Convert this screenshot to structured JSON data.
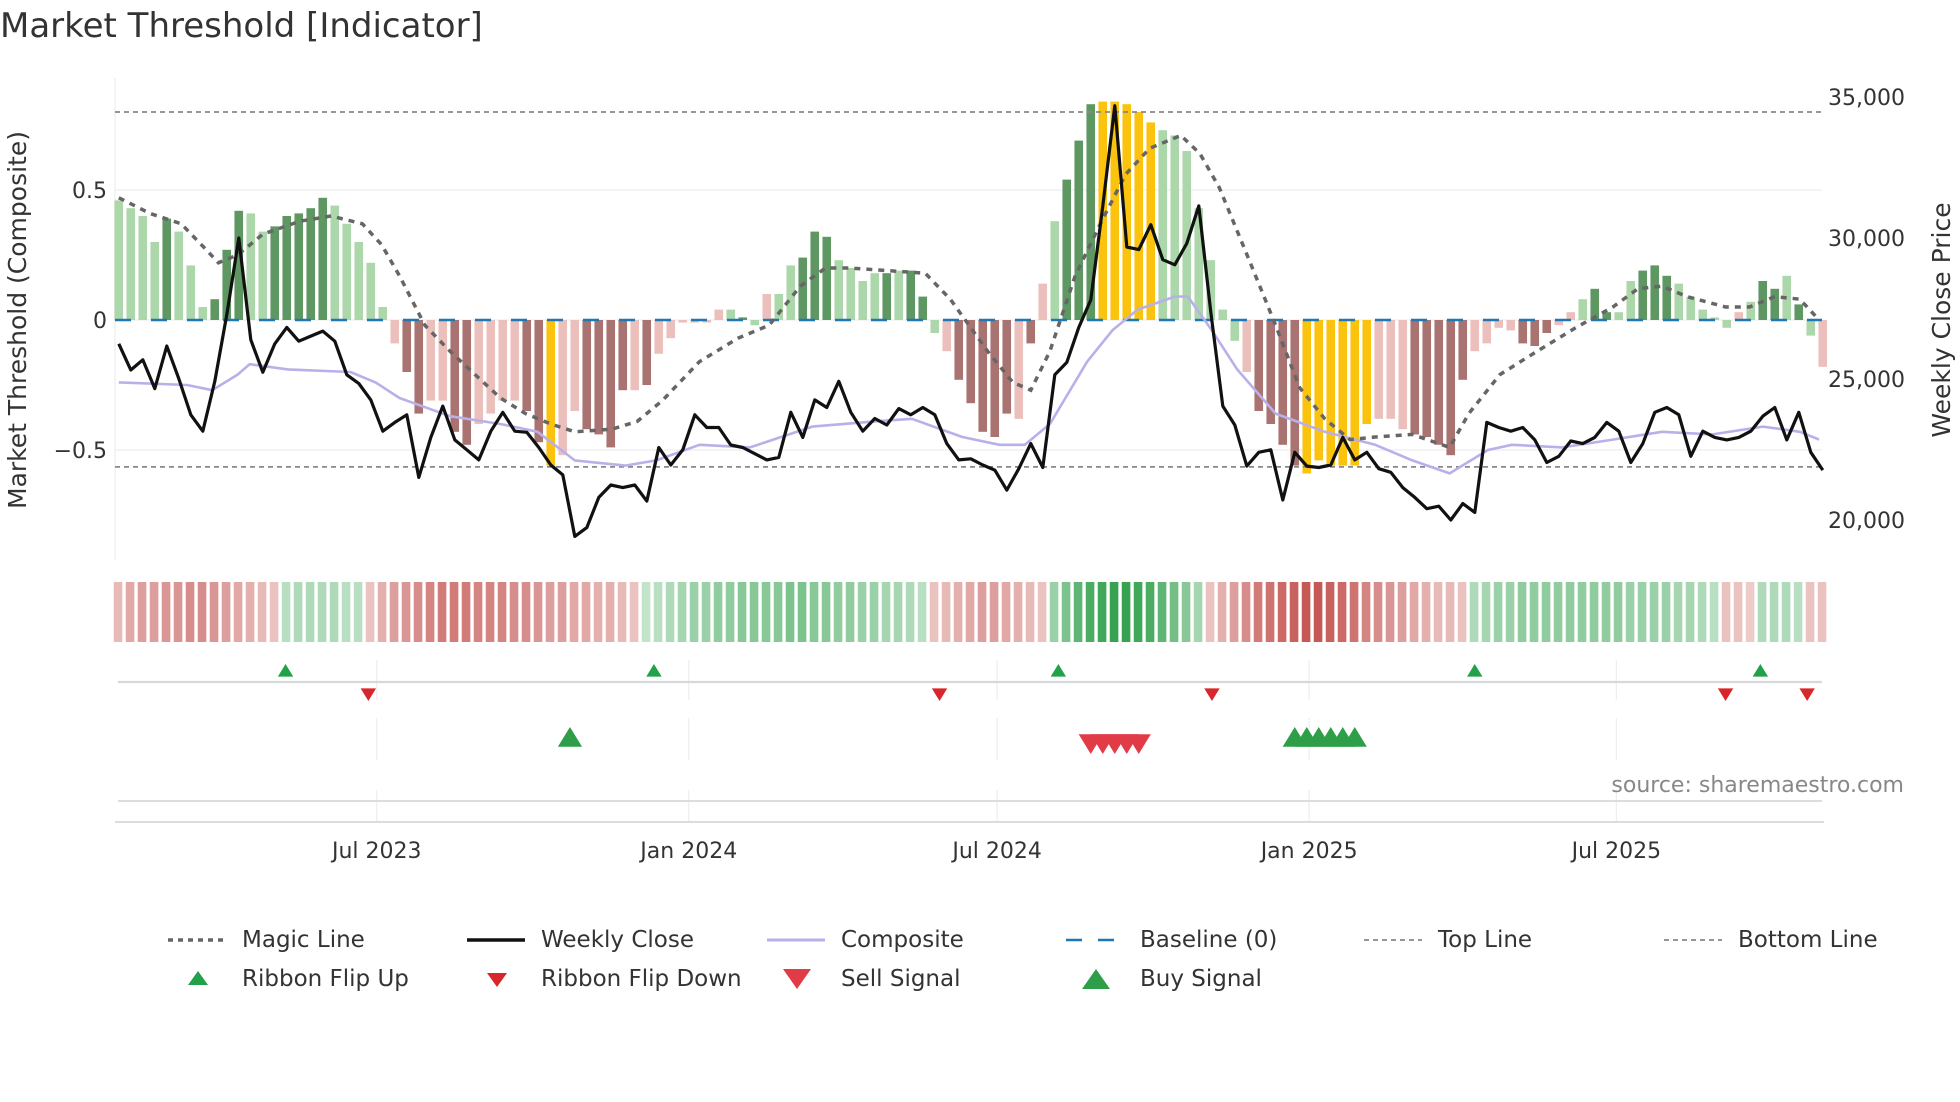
{
  "title": "Market Threshold [Indicator]",
  "source": "source: sharemaestro.com",
  "colors": {
    "bar_D": "#5f9763",
    "bar_L": "#acd7aa",
    "bar_d": "#a97371",
    "bar_l": "#ebc0bc",
    "bar_Y": "#fbc30d",
    "weekly_close": "#111111",
    "composite": "#b9b0ea",
    "magic": "#666666",
    "baseline": "#1f77b4",
    "ribbon_green": "#37a350",
    "ribbon_red": "#c2504c",
    "flip_up": "#21a148",
    "flip_down": "#d8262b",
    "sell": "#e23b48",
    "buy": "#2e9f48"
  },
  "chart_data": {
    "type": "bar+line",
    "title": "Market Threshold [Indicator]",
    "ylabel_left": "Market Threshold (Composite)",
    "ylabel_right": "Weekly Close Price",
    "ylim_left": [
      -0.94,
      0.92
    ],
    "ylim_right": [
      18600,
      36950
    ],
    "left_ticks": [
      {
        "v": 0.5,
        "label": "0.5"
      },
      {
        "v": 0,
        "label": "0"
      },
      {
        "v": -0.5,
        "label": "−0.5"
      }
    ],
    "right_ticks": [
      {
        "v": 35000,
        "label": "35,000"
      },
      {
        "v": 30000,
        "label": "30,000"
      },
      {
        "v": 25000,
        "label": "25,000"
      },
      {
        "v": 20000,
        "label": "20,000"
      }
    ],
    "x_ticks": [
      {
        "week": 21.5,
        "label": "Jul 2023"
      },
      {
        "week": 47.5,
        "label": "Jan 2024"
      },
      {
        "week": 73.2,
        "label": "Jul 2024"
      },
      {
        "week": 99.2,
        "label": "Jan 2025"
      },
      {
        "week": 124.8,
        "label": "Jul 2025"
      }
    ],
    "top_line": 0.8,
    "bottom_line": -0.565,
    "baseline": 0,
    "composite_bars": [
      0.46,
      0.43,
      0.4,
      0.3,
      0.39,
      0.34,
      0.21,
      0.05,
      0.08,
      0.27,
      0.42,
      0.41,
      0.34,
      0.36,
      0.4,
      0.41,
      0.43,
      0.47,
      0.44,
      0.37,
      0.3,
      0.22,
      0.05,
      -0.09,
      -0.2,
      -0.36,
      -0.31,
      -0.31,
      -0.43,
      -0.48,
      -0.4,
      -0.36,
      -0.31,
      -0.31,
      -0.35,
      -0.47,
      -0.56,
      -0.52,
      -0.35,
      -0.42,
      -0.44,
      -0.49,
      -0.27,
      -0.27,
      -0.25,
      -0.13,
      -0.07,
      -0.01,
      -0.01,
      -0.01,
      0.04,
      0.04,
      0.01,
      -0.02,
      0.1,
      0.1,
      0.21,
      0.24,
      0.34,
      0.32,
      0.23,
      0.2,
      0.15,
      0.18,
      0.18,
      0.19,
      0.19,
      0.09,
      -0.05,
      -0.12,
      -0.23,
      -0.32,
      -0.43,
      -0.45,
      -0.36,
      -0.38,
      -0.09,
      0.14,
      0.38,
      0.54,
      0.69,
      0.83,
      0.84,
      0.84,
      0.83,
      0.8,
      0.76,
      0.73,
      0.71,
      0.65,
      0.43,
      0.23,
      0.04,
      -0.08,
      -0.2,
      -0.35,
      -0.4,
      -0.48,
      -0.56,
      -0.59,
      -0.54,
      -0.56,
      -0.56,
      -0.56,
      -0.4,
      -0.38,
      -0.38,
      -0.42,
      -0.44,
      -0.45,
      -0.48,
      -0.52,
      -0.23,
      -0.12,
      -0.09,
      -0.03,
      -0.04,
      -0.09,
      -0.1,
      -0.05,
      -0.02,
      0.03,
      0.08,
      0.12,
      0.03,
      0.03,
      0.15,
      0.19,
      0.21,
      0.17,
      0.14,
      0.09,
      0.04,
      0.01,
      -0.03,
      0.03,
      0.07,
      0.15,
      0.12,
      0.17,
      0.06,
      -0.06,
      -0.18
    ],
    "bar_color_codes": "LLLLDLLLDDDLLDDDDDLLLLLlddllddllllddYllddddldllllllLDLlLLDDDLLLLDLDDLldddddldlLDDDYYYYYLLLLLLLlddddYYYYYYlllddddd llllddd llLDDLLDDDLLLLLlLDDLDLld",
    "weekly_close": [
      26250,
      25320,
      25680,
      24660,
      26170,
      25010,
      23730,
      23150,
      24920,
      27280,
      30000,
      26390,
      25240,
      26250,
      26830,
      26340,
      26520,
      26700,
      26340,
      25150,
      24840,
      24260,
      23150,
      23460,
      23730,
      21510,
      22930,
      24040,
      22840,
      22490,
      22130,
      23150,
      23820,
      23150,
      23110,
      22570,
      21950,
      21600,
      19420,
      19730,
      20800,
      21240,
      21150,
      21240,
      20670,
      22570,
      21950,
      22490,
      23730,
      23280,
      23280,
      22660,
      22570,
      22350,
      22130,
      22220,
      23820,
      22930,
      24260,
      23990,
      24920,
      23820,
      23150,
      23600,
      23370,
      23950,
      23730,
      23990,
      23730,
      22710,
      22130,
      22170,
      21950,
      21770,
      21060,
      21820,
      22710,
      21860,
      25150,
      25590,
      26830,
      27810,
      31140,
      34690,
      29680,
      29590,
      30470,
      29230,
      29050,
      29810,
      31140,
      27370,
      24040,
      23370,
      21910,
      22400,
      22490,
      20710,
      22400,
      21910,
      21860,
      21950,
      22930,
      22130,
      22400,
      21820,
      21690,
      21150,
      20800,
      20400,
      20490,
      20000,
      20580,
      20270,
      23460,
      23280,
      23150,
      23280,
      22840,
      22040,
      22260,
      22800,
      22710,
      22930,
      23460,
      23150,
      22040,
      22710,
      23820,
      23990,
      23730,
      22260,
      23150,
      22930,
      22840,
      22930,
      23150,
      23680,
      23990,
      22840,
      23820,
      22400,
      21770
    ],
    "composite_line": [
      [
        0,
        -0.24
      ],
      [
        5.7,
        -0.25
      ],
      [
        7.8,
        -0.27
      ],
      [
        9.9,
        -0.21
      ],
      [
        10.9,
        -0.17
      ],
      [
        14.1,
        -0.19
      ],
      [
        19.3,
        -0.2
      ],
      [
        21.4,
        -0.24
      ],
      [
        23.4,
        -0.3
      ],
      [
        27.6,
        -0.37
      ],
      [
        31.8,
        -0.4
      ],
      [
        34.9,
        -0.43
      ],
      [
        38,
        -0.54
      ],
      [
        42.2,
        -0.56
      ],
      [
        44.8,
        -0.54
      ],
      [
        48.4,
        -0.48
      ],
      [
        52.6,
        -0.49
      ],
      [
        57.8,
        -0.41
      ],
      [
        63,
        -0.39
      ],
      [
        66.1,
        -0.38
      ],
      [
        70.3,
        -0.45
      ],
      [
        73.4,
        -0.48
      ],
      [
        75.5,
        -0.48
      ],
      [
        77.6,
        -0.4
      ],
      [
        80.7,
        -0.16
      ],
      [
        82.8,
        -0.04
      ],
      [
        84.9,
        0.04
      ],
      [
        88,
        0.09
      ],
      [
        89.1,
        0.09
      ],
      [
        91.1,
        -0.04
      ],
      [
        93.2,
        -0.19
      ],
      [
        96.4,
        -0.36
      ],
      [
        100.5,
        -0.43
      ],
      [
        104.7,
        -0.48
      ],
      [
        107.8,
        -0.54
      ],
      [
        110.9,
        -0.59
      ],
      [
        114.1,
        -0.5
      ],
      [
        116.1,
        -0.48
      ],
      [
        120.3,
        -0.49
      ],
      [
        124.5,
        -0.46
      ],
      [
        128.6,
        -0.43
      ],
      [
        132.8,
        -0.44
      ],
      [
        137,
        -0.41
      ],
      [
        140.1,
        -0.43
      ],
      [
        141.7,
        -0.46
      ]
    ],
    "magic_line": [
      [
        0,
        0.47
      ],
      [
        2.6,
        0.41
      ],
      [
        5.2,
        0.37
      ],
      [
        7.3,
        0.27
      ],
      [
        8.3,
        0.22
      ],
      [
        9.9,
        0.25
      ],
      [
        12,
        0.33
      ],
      [
        15.1,
        0.38
      ],
      [
        17.7,
        0.4
      ],
      [
        20.3,
        0.37
      ],
      [
        21.9,
        0.29
      ],
      [
        23.4,
        0.17
      ],
      [
        25.5,
        -0.02
      ],
      [
        27.6,
        -0.12
      ],
      [
        29.7,
        -0.21
      ],
      [
        31.8,
        -0.3
      ],
      [
        33.9,
        -0.36
      ],
      [
        36,
        -0.4
      ],
      [
        38,
        -0.43
      ],
      [
        41.1,
        -0.42
      ],
      [
        43.2,
        -0.39
      ],
      [
        45.3,
        -0.31
      ],
      [
        48.4,
        -0.16
      ],
      [
        51.6,
        -0.07
      ],
      [
        54.2,
        -0.02
      ],
      [
        56.8,
        0.13
      ],
      [
        58.9,
        0.2
      ],
      [
        60.9,
        0.2
      ],
      [
        67.2,
        0.18
      ],
      [
        69.3,
        0.08
      ],
      [
        72.4,
        -0.12
      ],
      [
        74.5,
        -0.24
      ],
      [
        76,
        -0.27
      ],
      [
        77.6,
        -0.12
      ],
      [
        79.7,
        0.17
      ],
      [
        81.8,
        0.37
      ],
      [
        83.9,
        0.56
      ],
      [
        85.9,
        0.66
      ],
      [
        88.5,
        0.71
      ],
      [
        90.1,
        0.64
      ],
      [
        91.7,
        0.51
      ],
      [
        94.3,
        0.22
      ],
      [
        96.4,
        -0.02
      ],
      [
        98.4,
        -0.26
      ],
      [
        100.5,
        -0.38
      ],
      [
        102.6,
        -0.46
      ],
      [
        104.7,
        -0.45
      ],
      [
        107.8,
        -0.44
      ],
      [
        110.9,
        -0.49
      ],
      [
        112.5,
        -0.36
      ],
      [
        115.1,
        -0.21
      ],
      [
        118.2,
        -0.12
      ],
      [
        121.4,
        -0.03
      ],
      [
        124.5,
        0.05
      ],
      [
        126.6,
        0.12
      ],
      [
        128.6,
        0.13
      ],
      [
        130.7,
        0.09
      ],
      [
        133.9,
        0.05
      ],
      [
        135.9,
        0.05
      ],
      [
        138,
        0.09
      ],
      [
        140.1,
        0.08
      ],
      [
        141.7,
        0.0
      ]
    ],
    "ribbon": [
      -0.2,
      -0.3,
      -0.35,
      -0.35,
      -0.4,
      -0.4,
      -0.45,
      -0.45,
      -0.4,
      -0.35,
      -0.3,
      -0.25,
      -0.2,
      -0.15,
      0.15,
      0.2,
      0.2,
      0.2,
      0.2,
      0.15,
      0.15,
      -0.15,
      -0.25,
      -0.35,
      -0.4,
      -0.45,
      -0.5,
      -0.55,
      -0.55,
      -0.55,
      -0.5,
      -0.5,
      -0.5,
      -0.45,
      -0.45,
      -0.4,
      -0.35,
      -0.35,
      -0.3,
      -0.3,
      -0.25,
      -0.25,
      -0.2,
      -0.15,
      0.1,
      0.15,
      0.2,
      0.25,
      0.3,
      0.3,
      0.35,
      0.35,
      0.4,
      0.4,
      0.4,
      0.4,
      0.45,
      0.45,
      0.4,
      0.4,
      0.35,
      0.35,
      0.3,
      0.3,
      0.25,
      0.25,
      0.2,
      0.15,
      -0.15,
      -0.2,
      -0.25,
      -0.3,
      -0.35,
      -0.35,
      -0.3,
      -0.25,
      -0.2,
      -0.15,
      0.3,
      0.45,
      0.6,
      0.7,
      0.75,
      0.8,
      0.8,
      0.75,
      0.7,
      0.6,
      0.5,
      0.4,
      0.25,
      -0.15,
      -0.25,
      -0.35,
      -0.45,
      -0.55,
      -0.6,
      -0.65,
      -0.7,
      -0.75,
      -0.75,
      -0.7,
      -0.65,
      -0.6,
      -0.5,
      -0.45,
      -0.4,
      -0.35,
      -0.3,
      -0.25,
      -0.2,
      -0.2,
      -0.15,
      0.2,
      0.25,
      0.3,
      0.3,
      0.35,
      0.35,
      0.35,
      0.35,
      0.35,
      0.35,
      0.35,
      0.35,
      0.35,
      0.3,
      0.3,
      0.3,
      0.3,
      0.25,
      0.25,
      0.2,
      0.15,
      -0.15,
      -0.15,
      -0.1,
      0.2,
      0.2,
      0.2,
      0.15,
      -0.15,
      -0.15
    ],
    "ribbon_flip_up_weeks": [
      13.9,
      44.6,
      78.3,
      113,
      136.8
    ],
    "ribbon_flip_down_weeks": [
      20.8,
      68.4,
      91.1,
      133.9,
      140.7
    ],
    "sell_signal_weeks": [
      81,
      82,
      83,
      84,
      85
    ],
    "buy_signal_weeks": [
      37.6,
      98,
      99,
      100,
      101,
      102,
      103
    ],
    "legend": [
      {
        "label": "Magic Line",
        "symbol": "dotted-line"
      },
      {
        "label": "Weekly Close",
        "symbol": "solid-line"
      },
      {
        "label": "Composite",
        "symbol": "composite-line"
      },
      {
        "label": "Baseline (0)",
        "symbol": "dashed-line"
      },
      {
        "label": "Top Line",
        "symbol": "thin-dashed-line"
      },
      {
        "label": "Bottom Line",
        "symbol": "thin-dashed-line"
      },
      {
        "label": "Ribbon Flip Up",
        "symbol": "triangle-up-small"
      },
      {
        "label": "Ribbon Flip Down",
        "symbol": "triangle-down-small"
      },
      {
        "label": "Sell Signal",
        "symbol": "triangle-down-large"
      },
      {
        "label": "Buy Signal",
        "symbol": "triangle-up-large"
      }
    ]
  }
}
